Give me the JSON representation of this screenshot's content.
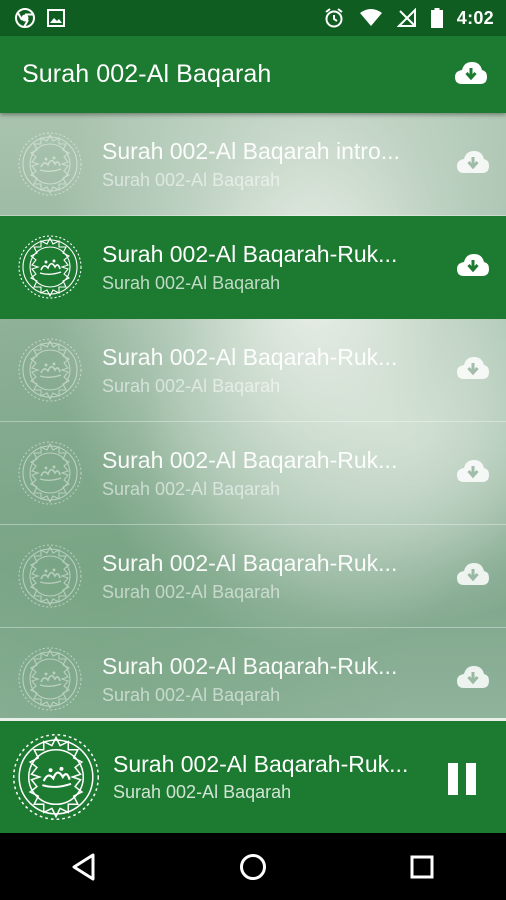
{
  "status_bar": {
    "time": "4:02",
    "icons": [
      "chrome-icon",
      "image-icon",
      "alarm-icon",
      "wifi-icon",
      "no-signal-icon",
      "battery-icon"
    ]
  },
  "app_bar": {
    "title": "Surah 002-Al Baqarah",
    "action_icon": "cloud-download-icon"
  },
  "list": {
    "items": [
      {
        "title": "Surah 002-Al Baqarah intro...",
        "subtitle": "Surah 002-Al Baqarah",
        "active": false
      },
      {
        "title": "Surah 002-Al Baqarah-Ruk...",
        "subtitle": "Surah 002-Al Baqarah",
        "active": true
      },
      {
        "title": "Surah 002-Al Baqarah-Ruk...",
        "subtitle": "Surah 002-Al Baqarah",
        "active": false
      },
      {
        "title": "Surah 002-Al Baqarah-Ruk...",
        "subtitle": "Surah 002-Al Baqarah",
        "active": false
      },
      {
        "title": "Surah 002-Al Baqarah-Ruk...",
        "subtitle": "Surah 002-Al Baqarah",
        "active": false
      },
      {
        "title": "Surah 002-Al Baqarah-Ruk...",
        "subtitle": "Surah 002-Al Baqarah",
        "active": false
      }
    ]
  },
  "player": {
    "title": "Surah 002-Al Baqarah-Ruk...",
    "subtitle": "Surah 002-Al Baqarah",
    "state_icon": "pause-icon"
  },
  "nav_bar": {
    "icons": [
      "back-icon",
      "home-icon",
      "recents-icon"
    ]
  },
  "colors": {
    "status_bar": "#0f5d20",
    "primary": "#1d7a31",
    "nav_bar": "#000000"
  }
}
